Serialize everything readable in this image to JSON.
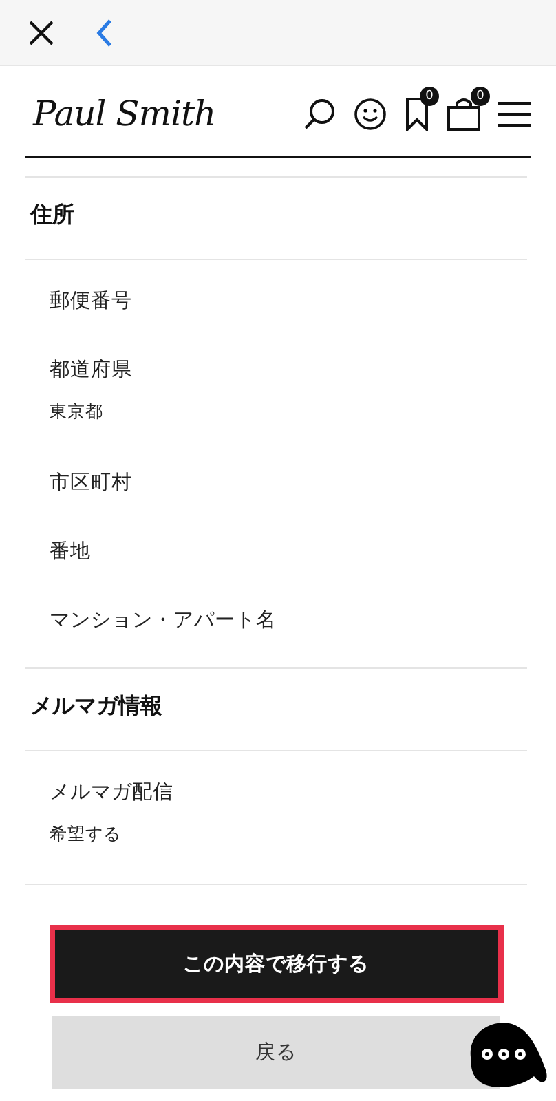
{
  "header": {
    "logo": "Paul Smith",
    "wishlist_count": "0",
    "cart_count": "0"
  },
  "sections": [
    {
      "title": "住所",
      "fields": [
        {
          "label": "郵便番号"
        },
        {
          "label": "都道府県",
          "value": "東京都"
        },
        {
          "label": "市区町村"
        },
        {
          "label": "番地"
        },
        {
          "label": "マンション・アパート名"
        }
      ]
    },
    {
      "title": "メルマガ情報",
      "fields": [
        {
          "label": "メルマガ配信",
          "value": "希望する"
        }
      ]
    }
  ],
  "buttons": [
    {
      "label": "この内容で移行する",
      "kind": "primary",
      "highlighted": true
    },
    {
      "label": "戻る",
      "kind": "secondary",
      "highlighted": false
    }
  ]
}
